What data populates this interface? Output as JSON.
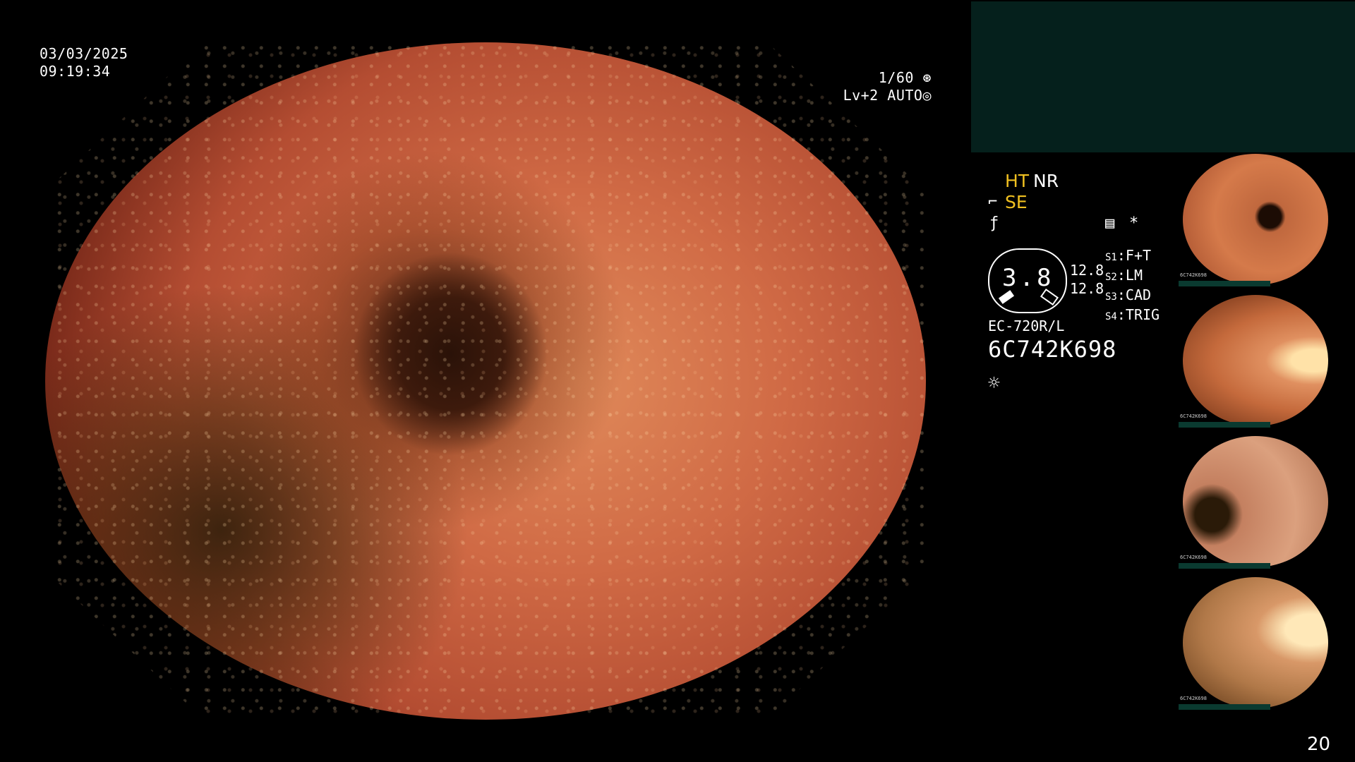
{
  "overlay": {
    "date": "03/03/2025",
    "time": "09:19:34",
    "shutter": "1/60",
    "level": "Lv+2",
    "mode": "AUTO"
  },
  "status": {
    "ht": "HT",
    "nr": "NR",
    "se": "SE",
    "gauge_value": "3.8",
    "readout_1": "12.8",
    "readout_2": "12.8",
    "modes": [
      {
        "key": "S1",
        "value": "F+T"
      },
      {
        "key": "S2",
        "value": "LM"
      },
      {
        "key": "S3",
        "value": "CAD"
      },
      {
        "key": "S4",
        "value": "TRIG"
      }
    ],
    "scope_model": "EC-720R/L",
    "serial": "6C742K698"
  },
  "thumbnails": [
    {
      "label": "6C742K698"
    },
    {
      "label": "6C742K698"
    },
    {
      "label": "6C742K698"
    },
    {
      "label": "6C742K698"
    }
  ],
  "page_number": "20",
  "colors": {
    "accent_yellow": "#f0c020",
    "panel_teal": "#05201c"
  }
}
